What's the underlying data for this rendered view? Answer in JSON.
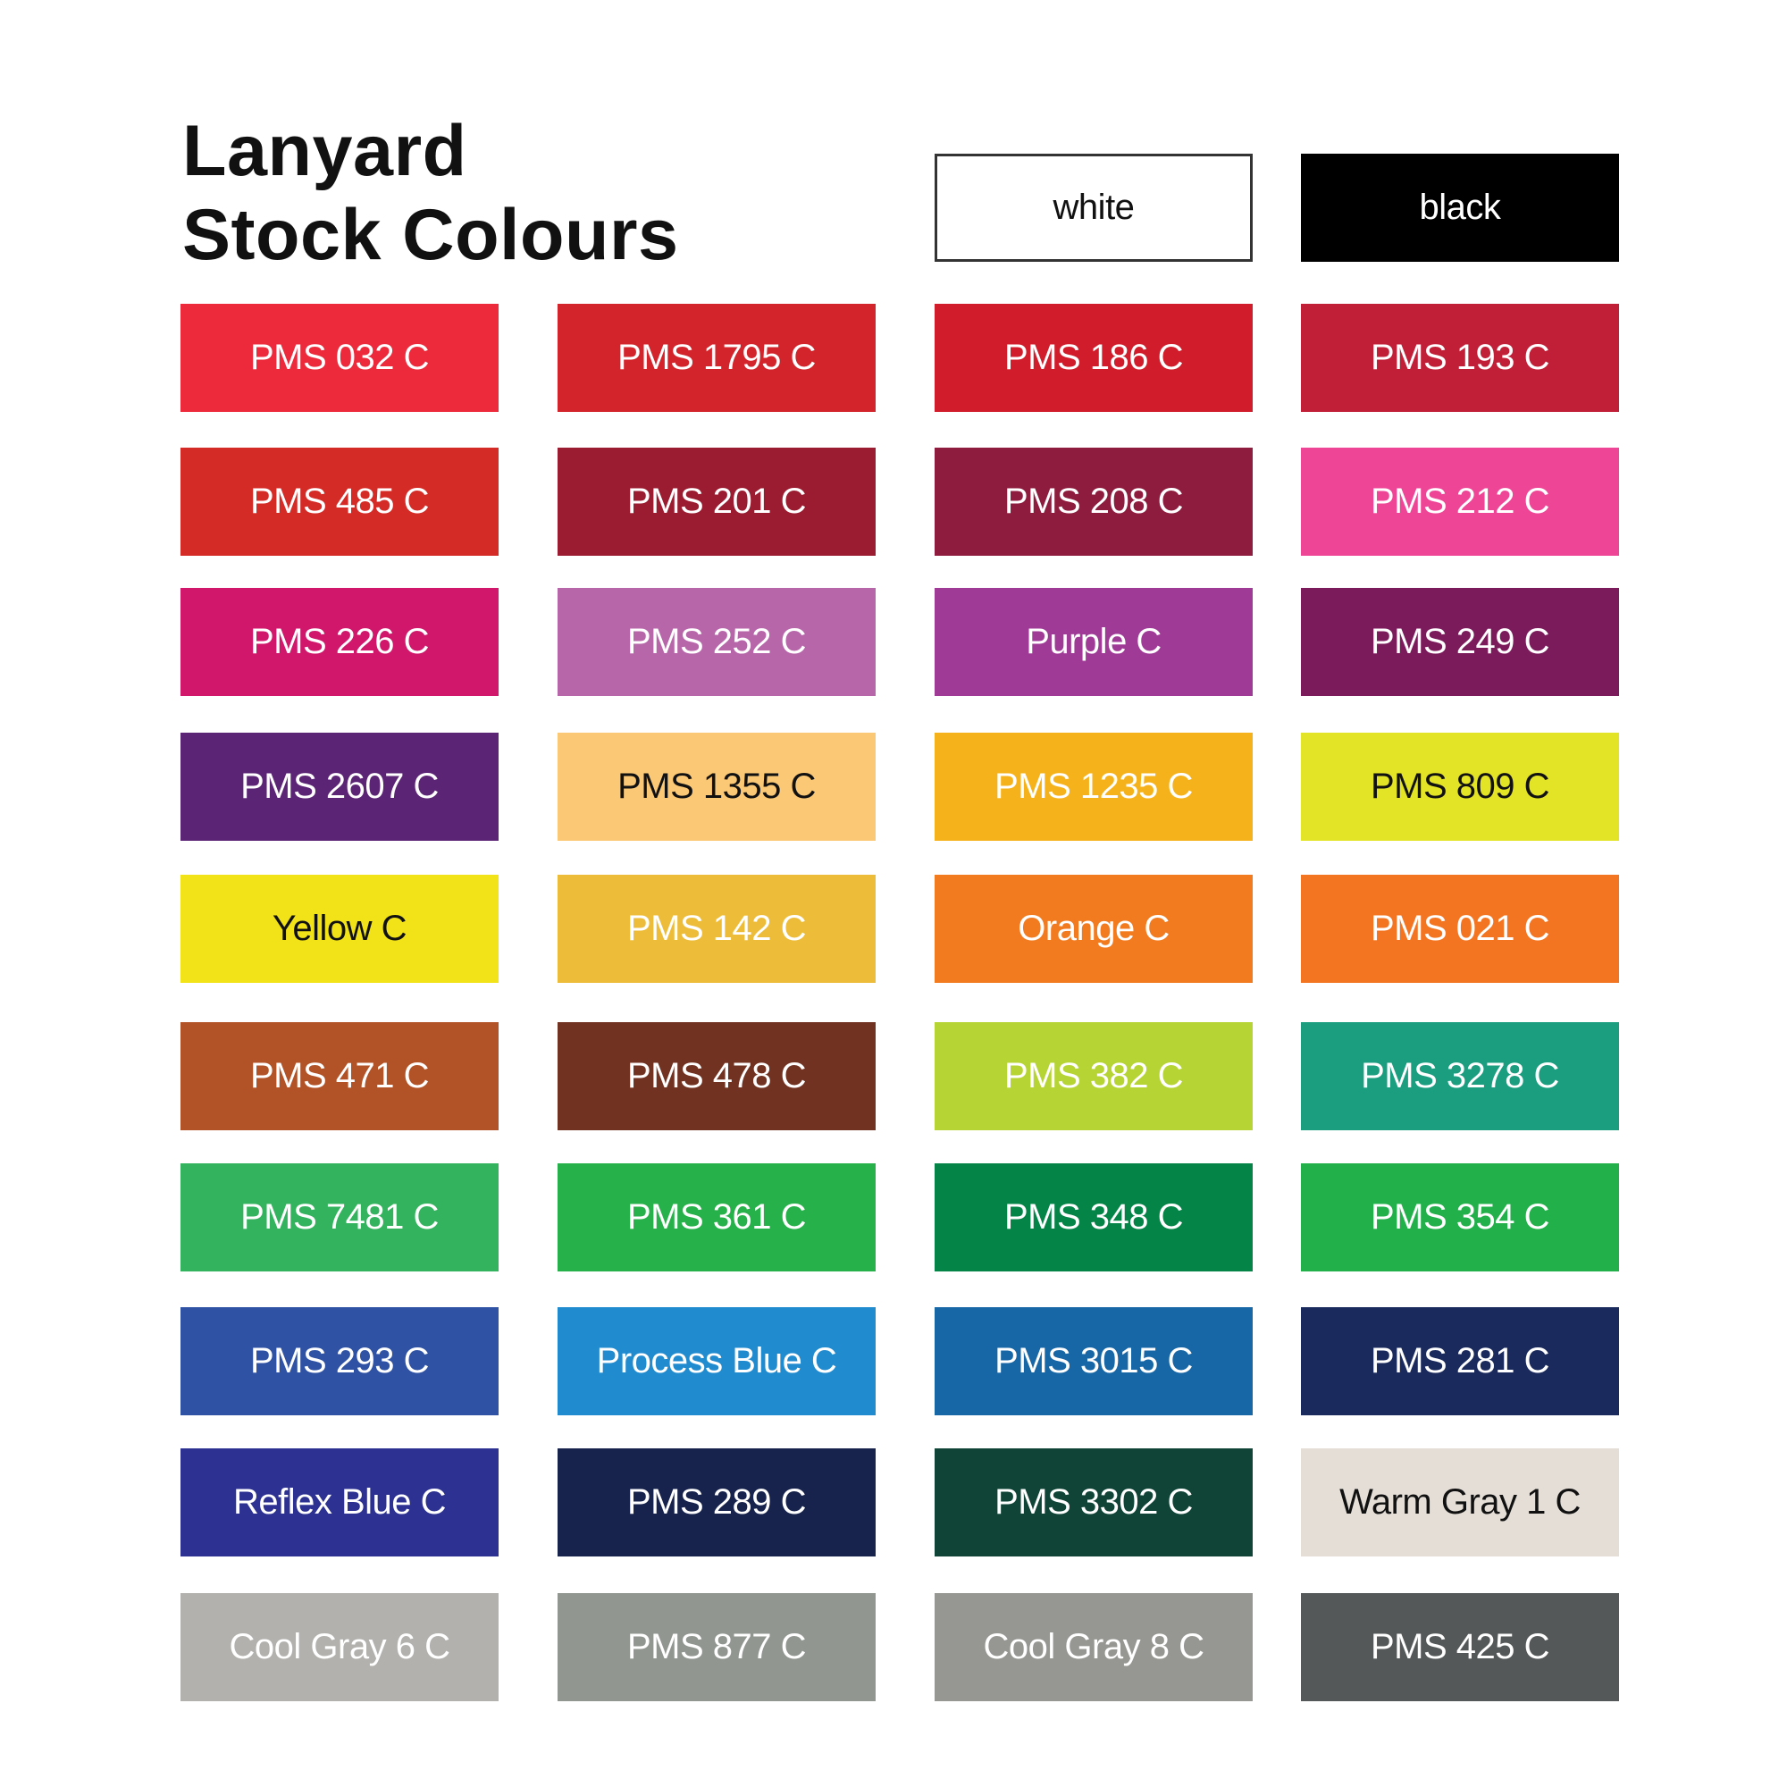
{
  "title": {
    "line1": "Lanyard",
    "line2": "Stock Colours"
  },
  "swatches": [
    {
      "label": "white",
      "bg": "#ffffff",
      "fg": "#111111",
      "bordered": true,
      "row": 0,
      "col": 2
    },
    {
      "label": "black",
      "bg": "#000000",
      "fg": "#ffffff",
      "row": 0,
      "col": 3
    },
    {
      "label": "PMS 032 C",
      "bg": "#ec2a3b",
      "fg": "#ffffff",
      "row": 1,
      "col": 0
    },
    {
      "label": "PMS 1795 C",
      "bg": "#d3242b",
      "fg": "#ffffff",
      "row": 1,
      "col": 1
    },
    {
      "label": "PMS 186 C",
      "bg": "#d01c2b",
      "fg": "#ffffff",
      "row": 1,
      "col": 2
    },
    {
      "label": "PMS 193 C",
      "bg": "#c11e37",
      "fg": "#ffffff",
      "row": 1,
      "col": 3
    },
    {
      "label": "PMS 485 C",
      "bg": "#d52b27",
      "fg": "#ffffff",
      "row": 2,
      "col": 0
    },
    {
      "label": "PMS 201 C",
      "bg": "#9b1b30",
      "fg": "#ffffff",
      "row": 2,
      "col": 1
    },
    {
      "label": "PMS 208 C",
      "bg": "#8e1c3e",
      "fg": "#ffffff",
      "row": 2,
      "col": 2
    },
    {
      "label": "PMS 212 C",
      "bg": "#ef4597",
      "fg": "#ffffff",
      "row": 2,
      "col": 3
    },
    {
      "label": "PMS 226 C",
      "bg": "#d0176b",
      "fg": "#ffffff",
      "row": 3,
      "col": 0
    },
    {
      "label": "PMS 252 C",
      "bg": "#b866aa",
      "fg": "#ffffff",
      "row": 3,
      "col": 1
    },
    {
      "label": "Purple C",
      "bg": "#a03a97",
      "fg": "#ffffff",
      "row": 3,
      "col": 2
    },
    {
      "label": "PMS 249 C",
      "bg": "#7c1b5c",
      "fg": "#ffffff",
      "row": 3,
      "col": 3
    },
    {
      "label": "PMS 2607 C",
      "bg": "#5b2474",
      "fg": "#ffffff",
      "row": 4,
      "col": 0
    },
    {
      "label": "PMS 1355 C",
      "bg": "#fbc875",
      "fg": "#111111",
      "row": 4,
      "col": 1
    },
    {
      "label": "PMS 1235 C",
      "bg": "#f6b21a",
      "fg": "#ffffff",
      "row": 4,
      "col": 2
    },
    {
      "label": "PMS 809 C",
      "bg": "#e3e426",
      "fg": "#111111",
      "row": 4,
      "col": 3
    },
    {
      "label": "Yellow C",
      "bg": "#f2e318",
      "fg": "#111111",
      "row": 5,
      "col": 0
    },
    {
      "label": "PMS 142 C",
      "bg": "#edbd3a",
      "fg": "#ffffff",
      "row": 5,
      "col": 1
    },
    {
      "label": "Orange C",
      "bg": "#f27b20",
      "fg": "#ffffff",
      "row": 5,
      "col": 2
    },
    {
      "label": "PMS 021 C",
      "bg": "#f47521",
      "fg": "#ffffff",
      "row": 5,
      "col": 3
    },
    {
      "label": "PMS 471 C",
      "bg": "#b25227",
      "fg": "#ffffff",
      "row": 6,
      "col": 0
    },
    {
      "label": "PMS 478 C",
      "bg": "#723222",
      "fg": "#ffffff",
      "row": 6,
      "col": 1
    },
    {
      "label": "PMS 382 C",
      "bg": "#b6d433",
      "fg": "#ffffff",
      "row": 6,
      "col": 2
    },
    {
      "label": "PMS 3278 C",
      "bg": "#1b9d7f",
      "fg": "#ffffff",
      "row": 6,
      "col": 3
    },
    {
      "label": "PMS 7481 C",
      "bg": "#34b35f",
      "fg": "#ffffff",
      "row": 7,
      "col": 0
    },
    {
      "label": "PMS 361 C",
      "bg": "#27b14a",
      "fg": "#ffffff",
      "row": 7,
      "col": 1
    },
    {
      "label": "PMS 348 C",
      "bg": "#058448",
      "fg": "#ffffff",
      "row": 7,
      "col": 2
    },
    {
      "label": "PMS 354 C",
      "bg": "#22b04b",
      "fg": "#ffffff",
      "row": 7,
      "col": 3
    },
    {
      "label": "PMS 293 C",
      "bg": "#2f52a5",
      "fg": "#ffffff",
      "row": 8,
      "col": 0
    },
    {
      "label": "Process Blue C",
      "bg": "#218bd0",
      "fg": "#ffffff",
      "row": 8,
      "col": 1
    },
    {
      "label": "PMS 3015 C",
      "bg": "#1766a6",
      "fg": "#ffffff",
      "row": 8,
      "col": 2
    },
    {
      "label": "PMS 281 C",
      "bg": "#1b2a5c",
      "fg": "#ffffff",
      "row": 8,
      "col": 3
    },
    {
      "label": "Reflex Blue C",
      "bg": "#2c3192",
      "fg": "#ffffff",
      "row": 9,
      "col": 0
    },
    {
      "label": "PMS 289 C",
      "bg": "#17234c",
      "fg": "#ffffff",
      "row": 9,
      "col": 1
    },
    {
      "label": "PMS 3302 C",
      "bg": "#0f4436",
      "fg": "#ffffff",
      "row": 9,
      "col": 2
    },
    {
      "label": "Warm Gray 1 C",
      "bg": "#e4ded7",
      "fg": "#111111",
      "row": 9,
      "col": 3
    },
    {
      "label": "Cool Gray 6 C",
      "bg": "#b2b1ae",
      "fg": "#ffffff",
      "row": 10,
      "col": 0
    },
    {
      "label": "PMS 877 C",
      "bg": "#919691",
      "fg": "#ffffff",
      "row": 10,
      "col": 1
    },
    {
      "label": "Cool Gray 8 C",
      "bg": "#969692",
      "fg": "#ffffff",
      "row": 10,
      "col": 2
    },
    {
      "label": "PMS 425 C",
      "bg": "#555859",
      "fg": "#ffffff",
      "row": 10,
      "col": 3
    }
  ]
}
